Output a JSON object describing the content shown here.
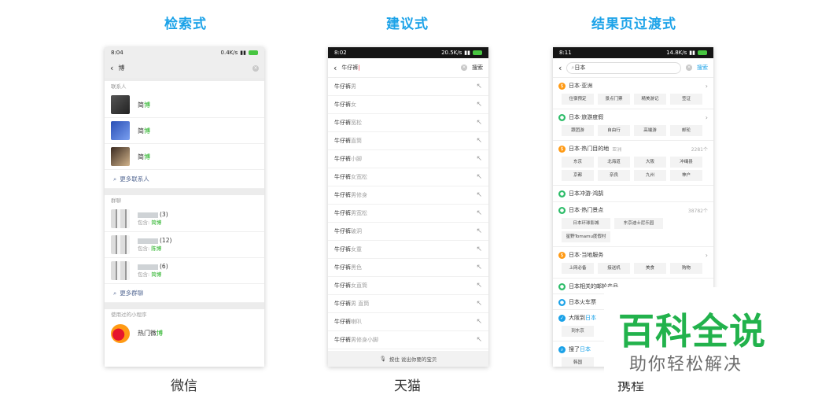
{
  "sections": {
    "search_style": "检索式",
    "suggest_style": "建议式",
    "transition_style": "结果页过渡式"
  },
  "captions": {
    "wechat": "微信",
    "tmall": "天猫",
    "ctrip": "携程"
  },
  "wechat": {
    "time": "8:04",
    "speed": "0.4K/s",
    "query": "博",
    "contacts_label": "联系人",
    "contacts": [
      {
        "name_prefix": "简",
        "name_hl": "博"
      },
      {
        "name_prefix": "简",
        "name_hl": "博"
      },
      {
        "name_prefix": "简",
        "name_hl": "博"
      }
    ],
    "more_contacts": "更多联系人",
    "groups_label": "群聊",
    "groups": [
      {
        "count": "(3)",
        "sub_prefix": "包含: ",
        "sub_hl": "简博"
      },
      {
        "count": "(12)",
        "sub_prefix": "包含: ",
        "sub_hl": "陈博"
      },
      {
        "count": "(6)",
        "sub_prefix": "包含: ",
        "sub_hl": "简博"
      }
    ],
    "more_groups": "更多群聊",
    "miniapp_label": "使用过的小程序",
    "miniapp": {
      "name_prefix": "热门微",
      "name_hl": "博"
    }
  },
  "tmall": {
    "time": "8:02",
    "speed": "20.5K/s",
    "query": "牛仔裤",
    "search_btn": "搜索",
    "suggestions": [
      {
        "q": "牛仔裤",
        "s": "男"
      },
      {
        "q": "牛仔裤",
        "s": "女"
      },
      {
        "q": "牛仔裤",
        "s": "宽松"
      },
      {
        "q": "牛仔裤",
        "s": "直筒"
      },
      {
        "q": "牛仔裤",
        "s": "小脚"
      },
      {
        "q": "牛仔裤",
        "s": "女宽松"
      },
      {
        "q": "牛仔裤",
        "s": "男修身"
      },
      {
        "q": "牛仔裤",
        "s": "男宽松"
      },
      {
        "q": "牛仔裤",
        "s": "破洞"
      },
      {
        "q": "牛仔裤",
        "s": "女童"
      },
      {
        "q": "牛仔裤",
        "s": "黑色"
      },
      {
        "q": "牛仔裤",
        "s": "女直筒"
      },
      {
        "q": "牛仔裤",
        "s": "男 直筒"
      },
      {
        "q": "牛仔裤",
        "s": "喇叭"
      },
      {
        "q": "牛仔裤",
        "s": "男修身小脚"
      }
    ],
    "voice_hint": "按住 说出你要的宝贝"
  },
  "ctrip": {
    "time": "8:11",
    "speed": "14.8K/s",
    "query": "日本",
    "search_btn": "搜索",
    "asia": {
      "title": "日本·亚洲",
      "tags": [
        "住宿预定",
        "景点门票",
        "精美游记",
        "签证"
      ]
    },
    "tour": {
      "title": "日本·旅游度假",
      "tags": [
        "跟团游",
        "自由行",
        "高端游",
        "邮轮"
      ]
    },
    "dest": {
      "title": "日本·热门目的地",
      "sub": "亚洲",
      "count": "2281个",
      "tags": [
        "东京",
        "北海道",
        "大阪",
        "冲绳县",
        "京都",
        "奈良",
        "九州",
        "神户"
      ]
    },
    "cruise": {
      "title": "日本冲游·鸿鹄"
    },
    "spots": {
      "title": "日本·热门景点",
      "count": "38782个",
      "tags": [
        "日本环球影城",
        "东京迪士尼乐园",
        "星野Tomamu度假村"
      ]
    },
    "local": {
      "title": "日本·当地服务",
      "tags": [
        "上网必备",
        "接送机",
        "美食",
        "购物"
      ]
    },
    "related": "日本相关的邮轮产品",
    "train": "日本火车票",
    "flight_prefix": "大阪到",
    "flight_hl": "日本",
    "flight_tag": "到东京",
    "search_prefix": "搜了",
    "search_hl": "日本",
    "search_tag": "韩国"
  },
  "watermark": {
    "big": "百科全说",
    "small": "助你轻松解决"
  }
}
